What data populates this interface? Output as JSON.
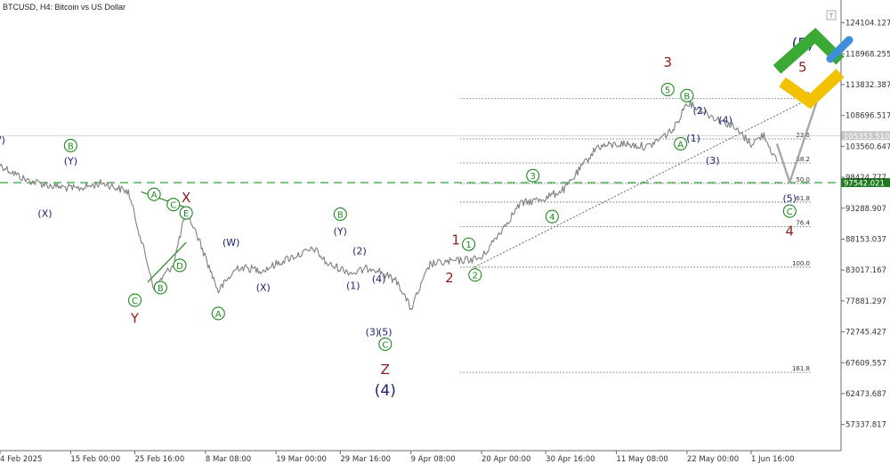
{
  "header": {
    "title": "BTCUSD, H4: Bitcoin vs US Dollar"
  },
  "colors": {
    "candle": "#7f7f7f",
    "green": "#1e8a1e",
    "navy": "#1c2373",
    "red": "#8b1a1a",
    "hline": "#44aa44",
    "price_badge": "#1e7a1e",
    "logo_green": "#3aaa35",
    "logo_yellow": "#f2c100",
    "logo_blue": "#3c8fd8"
  },
  "chart_data": {
    "type": "line",
    "title": "BTCUSD, H4: Bitcoin vs US Dollar",
    "xlabel": "",
    "ylabel": "",
    "ylim": [
      53000,
      127000
    ],
    "price_ticks": [
      "124104.127",
      "118968.255",
      "113832.387",
      "108696.517",
      "103560.647",
      "98424.777",
      "93288.907",
      "88153.037",
      "83017.167",
      "77881.297",
      "72745.427",
      "67609.557",
      "62473.687",
      "57337.817"
    ],
    "time_ticks": [
      "4 Feb 2025",
      "15 Feb 00:00",
      "25 Feb 16:00",
      "8 Mar 08:00",
      "19 Mar 00:00",
      "29 Mar 16:00",
      "9 Apr 08:00",
      "20 Apr 00:00",
      "30 Apr 16:00",
      "11 May 08:00",
      "22 May 00:00",
      "1 Jun 16:00"
    ],
    "current_price": "105353.510",
    "hline_price": "97542.021",
    "series": [
      {
        "x": [
          "4 Feb 2025",
          "8 Feb",
          "12 Feb",
          "16 Feb",
          "20 Feb",
          "24 Feb",
          "26 Feb",
          "28 Feb",
          "3 Mar",
          "5 Mar",
          "7 Mar",
          "10 Mar",
          "13 Mar",
          "17 Mar",
          "21 Mar",
          "25 Mar",
          "27 Mar",
          "31 Mar",
          "3 Apr",
          "7 Apr",
          "9 Apr",
          "12 Apr",
          "16 Apr",
          "20 Apr",
          "22 Apr",
          "26 Apr",
          "30 Apr",
          "3 May",
          "8 May",
          "12 May",
          "16 May",
          "20 May",
          "22 May",
          "26 May",
          "29 May",
          "1 Jun",
          "3 Jun",
          "5 Jun"
        ],
        "values": [
          100500,
          98000,
          97000,
          96500,
          97500,
          96000,
          88000,
          80000,
          84000,
          93000,
          88000,
          79500,
          83500,
          83000,
          85000,
          86500,
          84000,
          82500,
          83500,
          81000,
          76500,
          84000,
          84500,
          85000,
          88000,
          94000,
          95000,
          96500,
          103500,
          104000,
          103500,
          106500,
          111000,
          108500,
          107000,
          104000,
          105500,
          101000
        ]
      }
    ],
    "fib_levels": [
      {
        "label": "0.0",
        "value": 111500
      },
      {
        "label": "23.6",
        "value": 104800
      },
      {
        "label": "38.2",
        "value": 100800
      },
      {
        "label": "50.0",
        "value": 97400
      },
      {
        "label": "61.8",
        "value": 94300
      },
      {
        "label": "76.4",
        "value": 90200
      },
      {
        "label": "100.0",
        "value": 83500
      },
      {
        "label": "161.8",
        "value": 66000
      }
    ],
    "forecast": {
      "x": [
        "5 Jun",
        "7 Jun",
        "12 Jun"
      ],
      "values": [
        104000,
        97600,
        113500
      ]
    },
    "wave_labels": [
      {
        "text": "V)",
        "x": "4 Feb 2025",
        "y": 104800,
        "color": "navy",
        "style": "plain"
      },
      {
        "text": "B",
        "x": "15 Feb",
        "y": 103700,
        "color": "green",
        "style": "circle"
      },
      {
        "text": "(Y)",
        "x": "15 Feb",
        "y": 101300,
        "color": "navy",
        "style": "plain"
      },
      {
        "text": "(X)",
        "x": "11 Feb",
        "y": 92600,
        "color": "navy",
        "style": "plain"
      },
      {
        "text": "A",
        "x": "28 Feb",
        "y": 95600,
        "color": "green",
        "style": "circle"
      },
      {
        "text": "C",
        "x": "3 Mar",
        "y": 93900,
        "color": "green",
        "style": "circle"
      },
      {
        "text": "X",
        "x": "5 Mar",
        "y": 95000,
        "color": "red",
        "style": "plain"
      },
      {
        "text": "E",
        "x": "5 Mar",
        "y": 92500,
        "color": "green",
        "style": "circle"
      },
      {
        "text": "D",
        "x": "4 Mar",
        "y": 83800,
        "color": "green",
        "style": "circle"
      },
      {
        "text": "B",
        "x": "1 Mar",
        "y": 80100,
        "color": "green",
        "style": "circle"
      },
      {
        "text": "C",
        "x": "25 Feb",
        "y": 78000,
        "color": "green",
        "style": "circle"
      },
      {
        "text": "Y",
        "x": "25 Feb",
        "y": 75000,
        "color": "red",
        "style": "plain"
      },
      {
        "text": "A",
        "x": "10 Mar",
        "y": 75800,
        "color": "green",
        "style": "circle"
      },
      {
        "text": "(W)",
        "x": "12 Mar",
        "y": 87800,
        "color": "navy",
        "style": "plain"
      },
      {
        "text": "(X)",
        "x": "17 Mar",
        "y": 80300,
        "color": "navy",
        "style": "plain"
      },
      {
        "text": "B",
        "x": "29 Mar",
        "y": 92300,
        "color": "green",
        "style": "circle"
      },
      {
        "text": "(Y)",
        "x": "29 Mar",
        "y": 89600,
        "color": "navy",
        "style": "plain"
      },
      {
        "text": "(2)",
        "x": "1 Apr",
        "y": 86400,
        "color": "navy",
        "style": "plain"
      },
      {
        "text": "(1)",
        "x": "31 Mar",
        "y": 80600,
        "color": "navy",
        "style": "plain"
      },
      {
        "text": "(4)",
        "x": "4 Apr",
        "y": 81700,
        "color": "navy",
        "style": "plain"
      },
      {
        "text": "(3)",
        "x": "3 Apr",
        "y": 72900,
        "color": "navy",
        "style": "plain"
      },
      {
        "text": "(5)",
        "x": "5 Apr",
        "y": 72900,
        "color": "navy",
        "style": "plain"
      },
      {
        "text": "C",
        "x": "5 Apr",
        "y": 70700,
        "color": "green",
        "style": "circle"
      },
      {
        "text": "Z",
        "x": "5 Apr",
        "y": 66500,
        "color": "red",
        "style": "plain"
      },
      {
        "text": "(4)",
        "x": "5 Apr",
        "y": 63100,
        "color": "navy",
        "style": "large"
      },
      {
        "text": "1",
        "x": "16 Apr",
        "y": 88000,
        "color": "red",
        "style": "plain"
      },
      {
        "text": "2",
        "x": "15 Apr",
        "y": 81700,
        "color": "red",
        "style": "plain"
      },
      {
        "text": "1",
        "x": "18 Apr",
        "y": 87300,
        "color": "green",
        "style": "circle"
      },
      {
        "text": "2",
        "x": "19 Apr",
        "y": 82200,
        "color": "green",
        "style": "circle"
      },
      {
        "text": "3",
        "x": "28 Apr",
        "y": 98700,
        "color": "green",
        "style": "circle"
      },
      {
        "text": "4",
        "x": "1 May",
        "y": 91900,
        "color": "green",
        "style": "circle"
      },
      {
        "text": "3",
        "x": "19 May",
        "y": 117500,
        "color": "red",
        "style": "plain"
      },
      {
        "text": "5",
        "x": "19 May",
        "y": 113000,
        "color": "green",
        "style": "circle"
      },
      {
        "text": "B",
        "x": "22 May",
        "y": 112000,
        "color": "green",
        "style": "circle"
      },
      {
        "text": "(2)",
        "x": "24 May",
        "y": 109700,
        "color": "navy",
        "style": "plain"
      },
      {
        "text": "(1)",
        "x": "23 May",
        "y": 105100,
        "color": "navy",
        "style": "plain"
      },
      {
        "text": "A",
        "x": "21 May",
        "y": 104000,
        "color": "green",
        "style": "circle"
      },
      {
        "text": "(4)",
        "x": "28 May",
        "y": 108100,
        "color": "navy",
        "style": "plain"
      },
      {
        "text": "(3)",
        "x": "26 May",
        "y": 101400,
        "color": "navy",
        "style": "plain"
      },
      {
        "text": "(5)",
        "x": "7 Jun",
        "y": 95100,
        "color": "navy",
        "style": "plain"
      },
      {
        "text": "C",
        "x": "7 Jun",
        "y": 92800,
        "color": "green",
        "style": "circle"
      },
      {
        "text": "4",
        "x": "7 Jun",
        "y": 89500,
        "color": "red",
        "style": "plain"
      },
      {
        "text": "(5)",
        "x": "9 Jun",
        "y": 120600,
        "color": "navy",
        "style": "large"
      },
      {
        "text": "5",
        "x": "9 Jun",
        "y": 116700,
        "color": "red",
        "style": "plain"
      }
    ]
  }
}
